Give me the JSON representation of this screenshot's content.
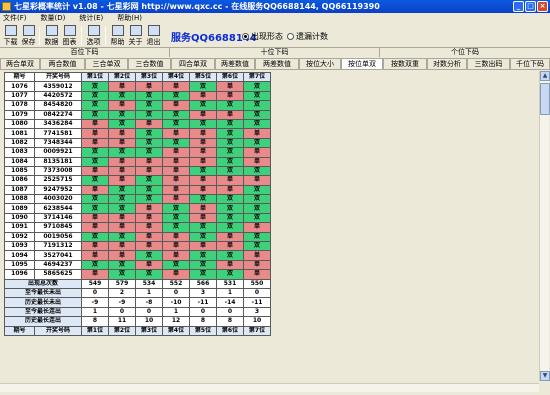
{
  "window": {
    "title": "七星彩概率统计 v1.08 - 七星彩网 http://www.qxc.cc - 在线服务QQ6688144, QQ66119390"
  },
  "menu": [
    "文件(F)",
    "数量(D)",
    "统计(E)",
    "帮助(H)"
  ],
  "toolbar": [
    {
      "label": "下载",
      "icon": "download-icon"
    },
    {
      "label": "保存",
      "icon": "save-icon"
    },
    {
      "label": "数据",
      "icon": "data-icon"
    },
    {
      "label": "图表",
      "icon": "chart-icon"
    },
    {
      "label": "选项",
      "icon": "options-icon"
    },
    {
      "label": "帮助",
      "icon": "help-icon"
    },
    {
      "label": "关于",
      "icon": "about-icon"
    },
    {
      "label": "退出",
      "icon": "exit-icon"
    }
  ],
  "service": "服务QQ6688144",
  "radios": [
    {
      "label": "出现形态",
      "checked": true
    },
    {
      "label": "遗漏计数",
      "checked": false
    }
  ],
  "groups": [
    "百位下码",
    "十位下码",
    "个位下码"
  ],
  "tabs": [
    "两合单双",
    "两合数值",
    "三合单双",
    "三合数值",
    "四合单双",
    "两差数值",
    "两差数值",
    "按位大小",
    "按位单双",
    "按数双重",
    "对数分析",
    "三数出码",
    "千位下码"
  ],
  "active_tab": 8,
  "columns": [
    "期号",
    "开奖号码",
    "第1位",
    "第2位",
    "第3位",
    "第4位",
    "第5位",
    "第6位",
    "第7位"
  ],
  "rows": [
    {
      "n": "1076",
      "code": "4359012",
      "v": [
        "双",
        "单",
        "单",
        "单",
        "双",
        "单",
        "双"
      ]
    },
    {
      "n": "1077",
      "code": "4420572",
      "v": [
        "双",
        "双",
        "双",
        "双",
        "单",
        "单",
        "双"
      ]
    },
    {
      "n": "1078",
      "code": "8454820",
      "v": [
        "双",
        "单",
        "双",
        "单",
        "双",
        "双",
        "双"
      ]
    },
    {
      "n": "1079",
      "code": "0842274",
      "v": [
        "双",
        "双",
        "双",
        "双",
        "单",
        "单",
        "双"
      ]
    },
    {
      "n": "1080",
      "code": "3436284",
      "v": [
        "单",
        "双",
        "单",
        "双",
        "双",
        "双",
        "双"
      ]
    },
    {
      "n": "1081",
      "code": "7741581",
      "v": [
        "单",
        "单",
        "双",
        "单",
        "单",
        "双",
        "单"
      ]
    },
    {
      "n": "1082",
      "code": "7348344",
      "v": [
        "单",
        "单",
        "双",
        "双",
        "单",
        "双",
        "双"
      ]
    },
    {
      "n": "1083",
      "code": "0009921",
      "v": [
        "双",
        "双",
        "双",
        "单",
        "单",
        "双",
        "单"
      ]
    },
    {
      "n": "1084",
      "code": "8135181",
      "v": [
        "双",
        "单",
        "单",
        "单",
        "单",
        "双",
        "单"
      ]
    },
    {
      "n": "1085",
      "code": "7373008",
      "v": [
        "单",
        "单",
        "单",
        "单",
        "双",
        "双",
        "双"
      ]
    },
    {
      "n": "1086",
      "code": "2525715",
      "v": [
        "双",
        "单",
        "双",
        "单",
        "单",
        "单",
        "单"
      ]
    },
    {
      "n": "1087",
      "code": "9247952",
      "v": [
        "单",
        "双",
        "双",
        "单",
        "单",
        "单",
        "双"
      ]
    },
    {
      "n": "1088",
      "code": "4003020",
      "v": [
        "双",
        "双",
        "双",
        "单",
        "双",
        "双",
        "双"
      ]
    },
    {
      "n": "1089",
      "code": "6238544",
      "v": [
        "双",
        "双",
        "单",
        "双",
        "单",
        "双",
        "双"
      ]
    },
    {
      "n": "1090",
      "code": "3714146",
      "v": [
        "单",
        "单",
        "单",
        "双",
        "单",
        "双",
        "双"
      ]
    },
    {
      "n": "1091",
      "code": "9710845",
      "v": [
        "单",
        "单",
        "单",
        "双",
        "双",
        "双",
        "单"
      ]
    },
    {
      "n": "1092",
      "code": "0019056",
      "v": [
        "双",
        "双",
        "单",
        "单",
        "双",
        "单",
        "双"
      ]
    },
    {
      "n": "1093",
      "code": "7191312",
      "v": [
        "单",
        "单",
        "单",
        "单",
        "单",
        "单",
        "双"
      ]
    },
    {
      "n": "1094",
      "code": "3527041",
      "v": [
        "单",
        "单",
        "双",
        "单",
        "双",
        "双",
        "单"
      ]
    },
    {
      "n": "1095",
      "code": "4694237",
      "v": [
        "双",
        "双",
        "单",
        "双",
        "双",
        "单",
        "单"
      ]
    },
    {
      "n": "1096",
      "code": "5865625",
      "v": [
        "单",
        "双",
        "双",
        "单",
        "双",
        "双",
        "单"
      ]
    }
  ],
  "stats": [
    {
      "label": "出现总次数",
      "v": [
        "549",
        "579",
        "534",
        "552",
        "566",
        "531",
        "550"
      ]
    },
    {
      "label": "至今最长未出",
      "v": [
        "0",
        "2",
        "1",
        "0",
        "3",
        "1",
        "0"
      ]
    },
    {
      "label": "历史最长未出",
      "v": [
        "-9",
        "-9",
        "-8",
        "-10",
        "-11",
        "-14",
        "-11"
      ]
    },
    {
      "label": "至今最长连出",
      "v": [
        "1",
        "0",
        "0",
        "1",
        "0",
        "0",
        "3"
      ]
    },
    {
      "label": "历史最长连出",
      "v": [
        "8",
        "11",
        "10",
        "12",
        "8",
        "8",
        "10"
      ]
    }
  ],
  "footer": [
    "期号",
    "开奖号码",
    "第1位",
    "第2位",
    "第3位",
    "第4位",
    "第5位",
    "第6位",
    "第7位"
  ]
}
